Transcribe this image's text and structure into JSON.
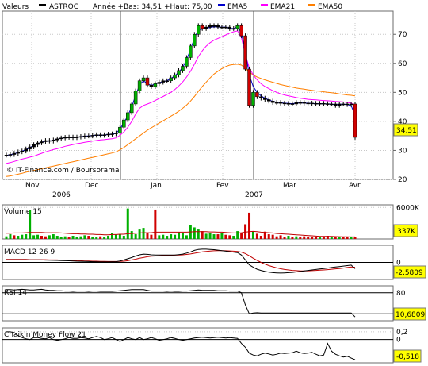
{
  "chart_data": {
    "type": "candlestick",
    "legend": {
      "values_label": "Valeurs",
      "ticker": "ASTROC",
      "year_range": "Année +Bas: 34,51 +Haut: 75,00",
      "ema5_label": "EMA5",
      "ema21_label": "EMA21",
      "ema50_label": "EMA50"
    },
    "colors": {
      "up": "#00b000",
      "down": "#d00000",
      "candle_neutral": "#000000",
      "ema5": "#0000cc",
      "ema21": "#ff00ff",
      "ema50": "#ff7f00",
      "volume_avg": "#c00000",
      "indicator_line": "#000000",
      "macd_signal": "#c00000",
      "value_tag": "#ffff00"
    },
    "watermark": "© IT-Finance.com / Boursorama",
    "x_axis": {
      "months": [
        "Nov",
        "Dec",
        "Jan",
        "Fev",
        "Mar",
        "Avr"
      ],
      "years": [
        "2006",
        "2007"
      ]
    },
    "price": {
      "ylim": [
        20,
        78
      ],
      "ticks": [
        "70",
        "60",
        "50",
        "40",
        "30",
        "20"
      ],
      "last_value": "34,51",
      "closes": [
        28.4,
        28.6,
        29.0,
        29.5,
        29.8,
        30.5,
        31.2,
        32.0,
        32.6,
        33.0,
        33.4,
        33.2,
        33.6,
        34.0,
        34.3,
        34.5,
        34.6,
        34.4,
        34.6,
        34.8,
        35.0,
        35.0,
        35.2,
        35.4,
        35.2,
        35.4,
        35.6,
        35.7,
        36.0,
        38.0,
        40.5,
        43.0,
        46.0,
        50.5,
        54.0,
        55.0,
        52.5,
        52.0,
        53.0,
        53.5,
        54.0,
        54.0,
        55.0,
        56.0,
        57.5,
        59.0,
        62.0,
        66.0,
        70.0,
        73.0,
        72.0,
        72.5,
        73.0,
        73.0,
        72.5,
        72.5,
        72.5,
        72.0,
        72.0,
        73.0,
        69.5,
        58.0,
        45.5,
        50.0,
        48.5,
        48.0,
        47.5,
        47.0,
        46.5,
        46.5,
        46.3,
        46.2,
        46.1,
        46.0,
        46.5,
        46.5,
        46.3,
        46.3,
        46.2,
        46.0,
        46.2,
        46.1,
        46.0,
        46.0,
        45.5,
        46.0,
        46.0,
        45.8,
        46.0,
        34.51
      ],
      "ema5": [
        28.3,
        28.5,
        28.8,
        29.3,
        29.7,
        30.3,
        31.0,
        31.7,
        32.3,
        32.8,
        33.2,
        33.2,
        33.5,
        33.9,
        34.2,
        34.4,
        34.5,
        34.4,
        34.5,
        34.7,
        34.9,
        35.0,
        35.1,
        35.3,
        35.2,
        35.3,
        35.5,
        35.6,
        35.9,
        37.4,
        39.5,
        42.0,
        45.0,
        49.0,
        52.5,
        54.0,
        53.0,
        52.4,
        52.9,
        53.3,
        53.8,
        54.0,
        54.8,
        55.7,
        57.0,
        58.6,
        61.2,
        64.8,
        68.7,
        71.6,
        71.8,
        72.1,
        72.4,
        72.6,
        72.5,
        72.5,
        72.5,
        72.1,
        72.0,
        72.6,
        70.5,
        64.0,
        56.0,
        52.0,
        50.0,
        48.8,
        48.0,
        47.4,
        46.9,
        46.6,
        46.4,
        46.3,
        46.2,
        46.1,
        46.3,
        46.4,
        46.3,
        46.3,
        46.2,
        46.1,
        46.1,
        46.1,
        46.0,
        46.0,
        45.7,
        45.9,
        45.9,
        45.8,
        45.4,
        42.0
      ],
      "ema21": [
        25.5,
        25.8,
        26.2,
        26.6,
        27.0,
        27.3,
        27.7,
        28.0,
        28.5,
        29.0,
        29.5,
        29.9,
        30.3,
        30.6,
        31.0,
        31.4,
        31.7,
        32.0,
        32.3,
        32.5,
        32.8,
        33.0,
        33.2,
        33.4,
        33.6,
        33.7,
        33.9,
        34.0,
        34.3,
        35.2,
        36.4,
        38.0,
        40.0,
        42.5,
        44.5,
        45.5,
        46.0,
        46.5,
        47.2,
        47.9,
        48.6,
        49.3,
        50.0,
        51.0,
        52.2,
        53.6,
        55.3,
        57.3,
        59.7,
        62.3,
        64.3,
        65.9,
        67.1,
        68.0,
        68.6,
        69.2,
        69.8,
        70.4,
        70.9,
        71.2,
        68.8,
        63.0,
        58.5,
        56.0,
        54.3,
        53.0,
        52.0,
        51.3,
        50.6,
        50.0,
        49.5,
        49.1,
        48.8,
        48.5,
        48.2,
        48.0,
        47.8,
        47.6,
        47.5,
        47.4,
        47.3,
        47.2,
        47.1,
        47.0,
        46.9,
        46.8,
        46.7,
        46.5,
        46.3,
        45.5
      ],
      "ema50": [
        21.0,
        21.2,
        21.5,
        21.8,
        22.1,
        22.5,
        22.8,
        23.1,
        23.4,
        23.7,
        24.0,
        24.3,
        24.6,
        24.9,
        25.2,
        25.5,
        25.8,
        26.1,
        26.4,
        26.7,
        27.0,
        27.3,
        27.6,
        27.9,
        28.2,
        28.5,
        28.8,
        29.1,
        29.5,
        30.2,
        31.0,
        32.0,
        33.0,
        34.0,
        35.0,
        36.0,
        37.0,
        37.8,
        38.6,
        39.4,
        40.2,
        41.0,
        41.8,
        42.6,
        43.5,
        44.5,
        45.6,
        47.0,
        48.6,
        50.3,
        52.0,
        53.5,
        55.0,
        56.3,
        57.3,
        58.2,
        58.9,
        59.4,
        59.6,
        59.7,
        59.4,
        58.3,
        57.0,
        56.0,
        55.3,
        54.8,
        54.3,
        53.9,
        53.5,
        53.1,
        52.7,
        52.4,
        52.1,
        51.8,
        51.5,
        51.3,
        51.1,
        50.9,
        50.7,
        50.5,
        50.4,
        50.2,
        50.0,
        49.9,
        49.7,
        49.5,
        49.3,
        49.1,
        49.0,
        48.8
      ]
    },
    "volume": {
      "label": "Volume 15",
      "ticks": [
        "6000K"
      ],
      "last_value": "337K",
      "ylim": [
        0,
        6500
      ],
      "values": [
        500,
        900,
        700,
        600,
        800,
        900,
        5500,
        700,
        800,
        600,
        500,
        700,
        900,
        600,
        400,
        500,
        300,
        600,
        400,
        500,
        700,
        600,
        400,
        300,
        500,
        400,
        600,
        1200,
        800,
        900,
        600,
        5800,
        1500,
        900,
        1800,
        2100,
        1200,
        800,
        5600,
        700,
        800,
        600,
        900,
        800,
        1300,
        1200,
        700,
        2600,
        2200,
        1800,
        1500,
        1000,
        1100,
        900,
        900,
        1200,
        800,
        700,
        600,
        1500,
        1200,
        2800,
        5000,
        1500,
        1000,
        600,
        1400,
        900,
        800,
        500,
        700,
        400,
        600,
        400,
        500,
        300,
        500,
        400,
        350,
        400,
        300,
        350,
        600,
        300,
        400,
        300,
        400,
        350,
        300,
        337
      ],
      "up": [
        true,
        true,
        false,
        true,
        true,
        true,
        true,
        true,
        true,
        false,
        false,
        true,
        true,
        true,
        true,
        true,
        false,
        true,
        true,
        true,
        true,
        false,
        true,
        true,
        false,
        true,
        true,
        true,
        true,
        true,
        true,
        true,
        true,
        true,
        true,
        true,
        false,
        false,
        false,
        true,
        true,
        true,
        true,
        true,
        true,
        true,
        true,
        true,
        true,
        true,
        false,
        true,
        true,
        true,
        false,
        true,
        false,
        false,
        true,
        true,
        false,
        false,
        false,
        true,
        false,
        false,
        false,
        false,
        false,
        false,
        false,
        false,
        true,
        false,
        true,
        false,
        false,
        false,
        false,
        false,
        true,
        false,
        false,
        true,
        false,
        true,
        false,
        false,
        true,
        false
      ],
      "avg": [
        1100,
        1100,
        1150,
        1150,
        1150,
        1200,
        1250,
        1250,
        1250,
        1250,
        1200,
        1200,
        1200,
        1200,
        1150,
        1100,
        1050,
        1000,
        1000,
        950,
        950,
        900,
        900,
        850,
        850,
        800,
        800,
        850,
        850,
        900,
        900,
        1000,
        1050,
        1100,
        1150,
        1200,
        1200,
        1200,
        1300,
        1300,
        1300,
        1300,
        1300,
        1300,
        1300,
        1300,
        1300,
        1350,
        1400,
        1400,
        1400,
        1400,
        1350,
        1350,
        1300,
        1300,
        1250,
        1200,
        1150,
        1150,
        1200,
        1300,
        1400,
        1450,
        1400,
        1300,
        1250,
        1200,
        1150,
        1050,
        1000,
        950,
        900,
        850,
        800,
        750,
        700,
        650,
        600,
        550,
        500,
        500,
        500,
        480,
        460,
        440,
        420,
        410,
        400,
        390
      ]
    },
    "macd": {
      "label": "MACD 12 26 9",
      "ticks": [
        "0"
      ],
      "last_value": "-2,5809",
      "ylim": [
        -7,
        7
      ],
      "macd": [
        1.0,
        1.0,
        1.0,
        1.0,
        1.0,
        1.0,
        1.0,
        1.0,
        1.0,
        1.0,
        0.95,
        0.9,
        0.85,
        0.8,
        0.75,
        0.7,
        0.65,
        0.6,
        0.5,
        0.45,
        0.4,
        0.35,
        0.3,
        0.25,
        0.2,
        0.2,
        0.2,
        0.25,
        0.3,
        0.6,
        1.0,
        1.5,
        2.0,
        2.6,
        3.1,
        3.4,
        3.3,
        3.1,
        3.0,
        3.0,
        3.0,
        3.0,
        3.0,
        3.0,
        3.2,
        3.4,
        3.8,
        4.3,
        4.9,
        5.3,
        5.4,
        5.4,
        5.3,
        5.2,
        5.0,
        4.8,
        4.6,
        4.4,
        4.2,
        4.0,
        3.0,
        1.0,
        -1.0,
        -2.0,
        -2.8,
        -3.3,
        -3.7,
        -4.0,
        -4.2,
        -4.3,
        -4.35,
        -4.3,
        -4.2,
        -4.1,
        -3.9,
        -3.7,
        -3.5,
        -3.3,
        -3.1,
        -2.9,
        -2.7,
        -2.5,
        -2.3,
        -2.1,
        -1.9,
        -1.7,
        -1.5,
        -1.3,
        -1.1,
        -2.58
      ],
      "signal": [
        1.2,
        1.2,
        1.2,
        1.2,
        1.2,
        1.2,
        1.1,
        1.1,
        1.1,
        1.1,
        1.1,
        1.0,
        1.0,
        1.0,
        0.9,
        0.9,
        0.8,
        0.8,
        0.7,
        0.7,
        0.6,
        0.6,
        0.5,
        0.5,
        0.4,
        0.4,
        0.35,
        0.35,
        0.35,
        0.4,
        0.5,
        0.7,
        1.0,
        1.3,
        1.7,
        2.0,
        2.3,
        2.5,
        2.6,
        2.7,
        2.8,
        2.85,
        2.9,
        2.95,
        3.0,
        3.1,
        3.25,
        3.45,
        3.75,
        4.05,
        4.3,
        4.5,
        4.65,
        4.75,
        4.8,
        4.8,
        4.75,
        4.7,
        4.6,
        4.5,
        4.2,
        3.6,
        2.7,
        1.7,
        0.8,
        0.0,
        -0.7,
        -1.3,
        -1.8,
        -2.2,
        -2.6,
        -2.9,
        -3.1,
        -3.3,
        -3.4,
        -3.5,
        -3.5,
        -3.45,
        -3.4,
        -3.3,
        -3.2,
        -3.1,
        -2.95,
        -2.8,
        -2.65,
        -2.5,
        -2.3,
        -2.1,
        -1.9,
        -2.0
      ]
    },
    "rsi": {
      "label": "RSI 14",
      "ticks": [
        "80",
        "20"
      ],
      "last_value": "10,6809",
      "ylim": [
        0,
        100
      ],
      "values": [
        89,
        89,
        88,
        89,
        90,
        89,
        88,
        88,
        89,
        90,
        88,
        87,
        87,
        86,
        86,
        85,
        85,
        84,
        85,
        85,
        85,
        84,
        85,
        85,
        84,
        84,
        84,
        84,
        85,
        86,
        87,
        88,
        89,
        89,
        89,
        89,
        87,
        85,
        85,
        85,
        85,
        84,
        85,
        84,
        84,
        85,
        85,
        86,
        87,
        88,
        87,
        87,
        87,
        87,
        86,
        86,
        86,
        85,
        85,
        85,
        80,
        45,
        20,
        22,
        23,
        22,
        22,
        22,
        22,
        22,
        22,
        22,
        22,
        22,
        22,
        22,
        22,
        22,
        22,
        22,
        22,
        22,
        22,
        22,
        22,
        22,
        22,
        22,
        22,
        11
      ]
    },
    "chaikin": {
      "label": "Chaikin Money Flow 21",
      "ticks": [
        "0,2",
        "0"
      ],
      "last_value": "-0,518",
      "ylim": [
        -0.6,
        0.3
      ],
      "values": [
        0.2,
        0.2,
        0.18,
        0.1,
        0.05,
        0.02,
        0.0,
        0.05,
        0.05,
        0.03,
        0.02,
        0.05,
        0.0,
        -0.02,
        0.0,
        0.02,
        0.05,
        0.03,
        0.03,
        0.05,
        0.04,
        0.02,
        0.05,
        0.08,
        0.05,
        0.0,
        0.02,
        0.05,
        0.0,
        -0.05,
        0.0,
        0.05,
        0.02,
        0.0,
        0.05,
        0.0,
        0.02,
        0.05,
        0.02,
        -0.02,
        0.0,
        0.02,
        0.05,
        0.03,
        0.0,
        -0.02,
        0.0,
        0.02,
        0.04,
        0.05,
        0.06,
        0.05,
        0.04,
        0.05,
        0.06,
        0.05,
        0.04,
        0.05,
        0.04,
        0.03,
        -0.1,
        -0.2,
        -0.35,
        -0.4,
        -0.42,
        -0.38,
        -0.35,
        -0.37,
        -0.4,
        -0.38,
        -0.35,
        -0.36,
        -0.35,
        -0.34,
        -0.3,
        -0.34,
        -0.36,
        -0.35,
        -0.33,
        -0.38,
        -0.42,
        -0.4,
        -0.1,
        -0.3,
        -0.38,
        -0.42,
        -0.45,
        -0.43,
        -0.48,
        -0.52
      ]
    }
  }
}
